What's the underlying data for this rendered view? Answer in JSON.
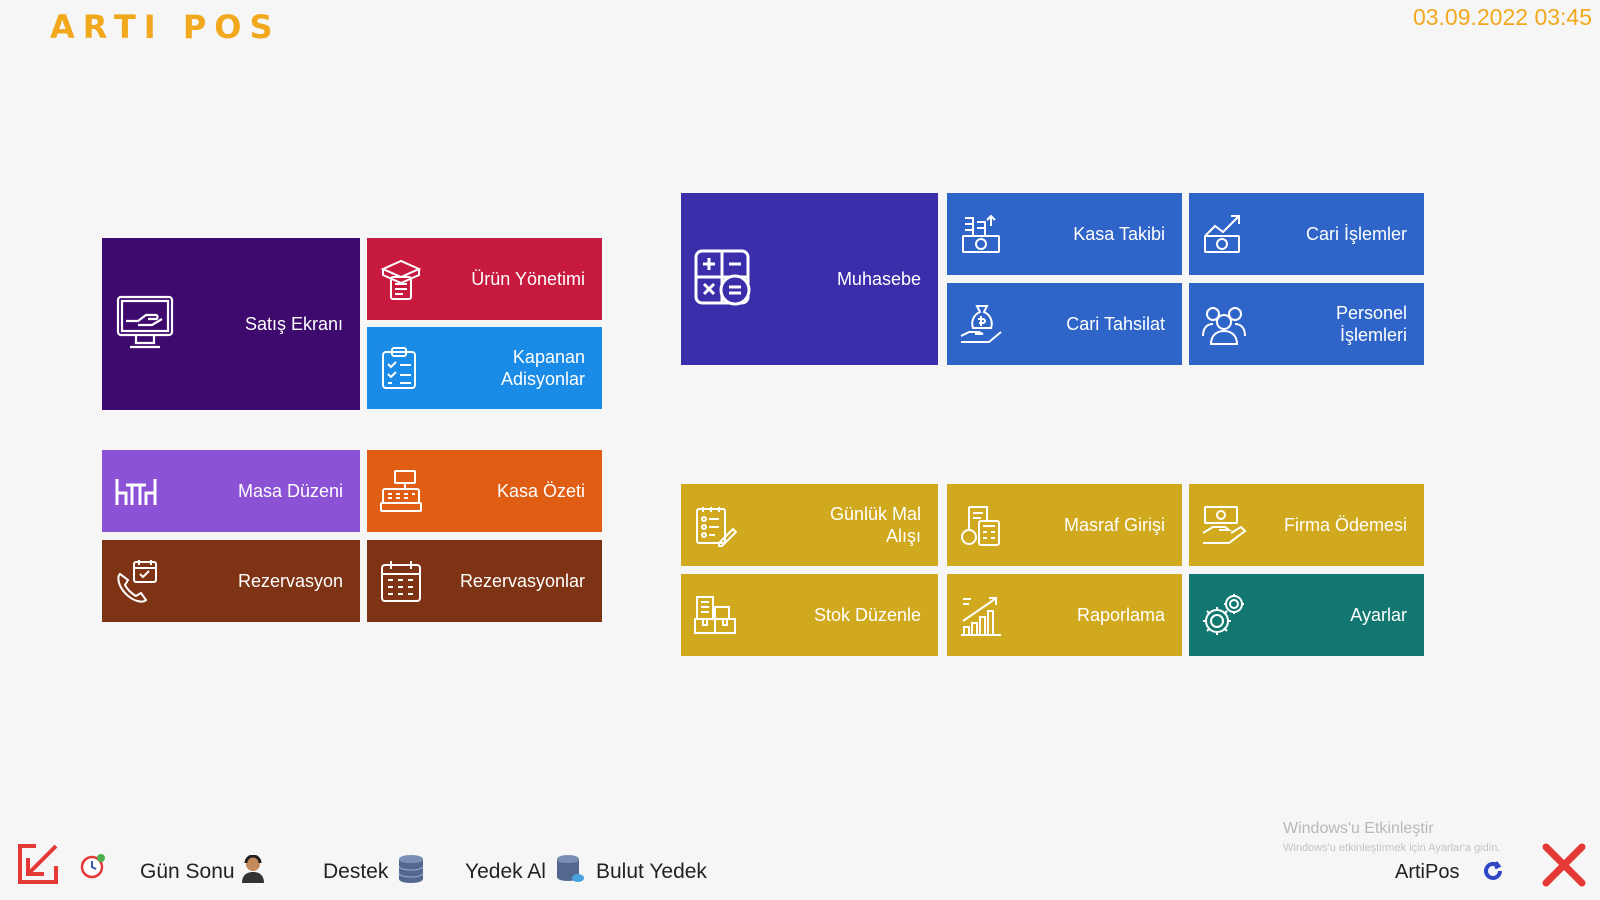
{
  "header": {
    "logo": "ARTI POS",
    "datetime": "03.09.2022 03:45"
  },
  "tiles": {
    "satis_ekrani": {
      "label": "Satış Ekranı",
      "icon": "monitor-hand-icon",
      "color": "#3f0a6e"
    },
    "urun_yonetimi": {
      "label": "Ürün Yönetimi",
      "icon": "product-box-icon",
      "color": "#c8193f"
    },
    "kapanan_adisyonlar": {
      "label": "Kapanan\nAdisyonlar",
      "icon": "clipboard-checklist-icon",
      "color": "#1a8be6"
    },
    "masa_duzeni": {
      "label": "Masa Düzeni",
      "icon": "table-chairs-icon",
      "color": "#8b52d6"
    },
    "kasa_ozeti": {
      "label": "Kasa Özeti",
      "icon": "cash-register-icon",
      "color": "#e05d14"
    },
    "rezervasyon": {
      "label": "Rezervasyon",
      "icon": "phone-calendar-icon",
      "color": "#7e3414"
    },
    "rezervasyonlar": {
      "label": "Rezervasyonlar",
      "icon": "calendar-grid-icon",
      "color": "#7e3414"
    },
    "muhasebe": {
      "label": "Muhasebe",
      "icon": "calculator-icon",
      "color": "#3a2eaa"
    },
    "kasa_takibi": {
      "label": "Kasa Takibi",
      "icon": "money-stack-icon",
      "color": "#2f64c8"
    },
    "cari_islemler": {
      "label": "Cari İşlemler",
      "icon": "money-chart-icon",
      "color": "#2f64c8"
    },
    "cari_tahsilat": {
      "label": "Cari Tahsilat",
      "icon": "money-bag-hand-icon",
      "color": "#2f64c8"
    },
    "personel_islemleri": {
      "label": "Personel\nİşlemleri",
      "icon": "people-group-icon",
      "color": "#2f64c8"
    },
    "gunluk_mal_alisi": {
      "label": "Günlük Mal\nAlışı",
      "icon": "checklist-pen-icon",
      "color": "#d1a91e"
    },
    "masraf_girisi": {
      "label": "Masraf Girişi",
      "icon": "receipt-calculator-icon",
      "color": "#d1a91e"
    },
    "firma_odemesi": {
      "label": "Firma Ödemesi",
      "icon": "hand-money-icon",
      "color": "#d1a91e"
    },
    "stok_duzenle": {
      "label": "Stok Düzenle",
      "icon": "boxes-icon",
      "color": "#d1a91e"
    },
    "raporlama": {
      "label": "Raporlama",
      "icon": "bar-growth-icon",
      "color": "#d1a91e"
    },
    "ayarlar": {
      "label": "Ayarlar",
      "icon": "gears-icon",
      "color": "#127770"
    }
  },
  "bottom": {
    "gun_sonu": "Gün Sonu",
    "destek": "Destek",
    "yedek_al": "Yedek Al",
    "bulut_yedek": "Bulut Yedek",
    "app_name": "ArtiPos",
    "watermark_title": "Windows'u Etkinleştir",
    "watermark_sub": "Windows'u etkinleştirmek için Ayarlar'a gidin."
  }
}
